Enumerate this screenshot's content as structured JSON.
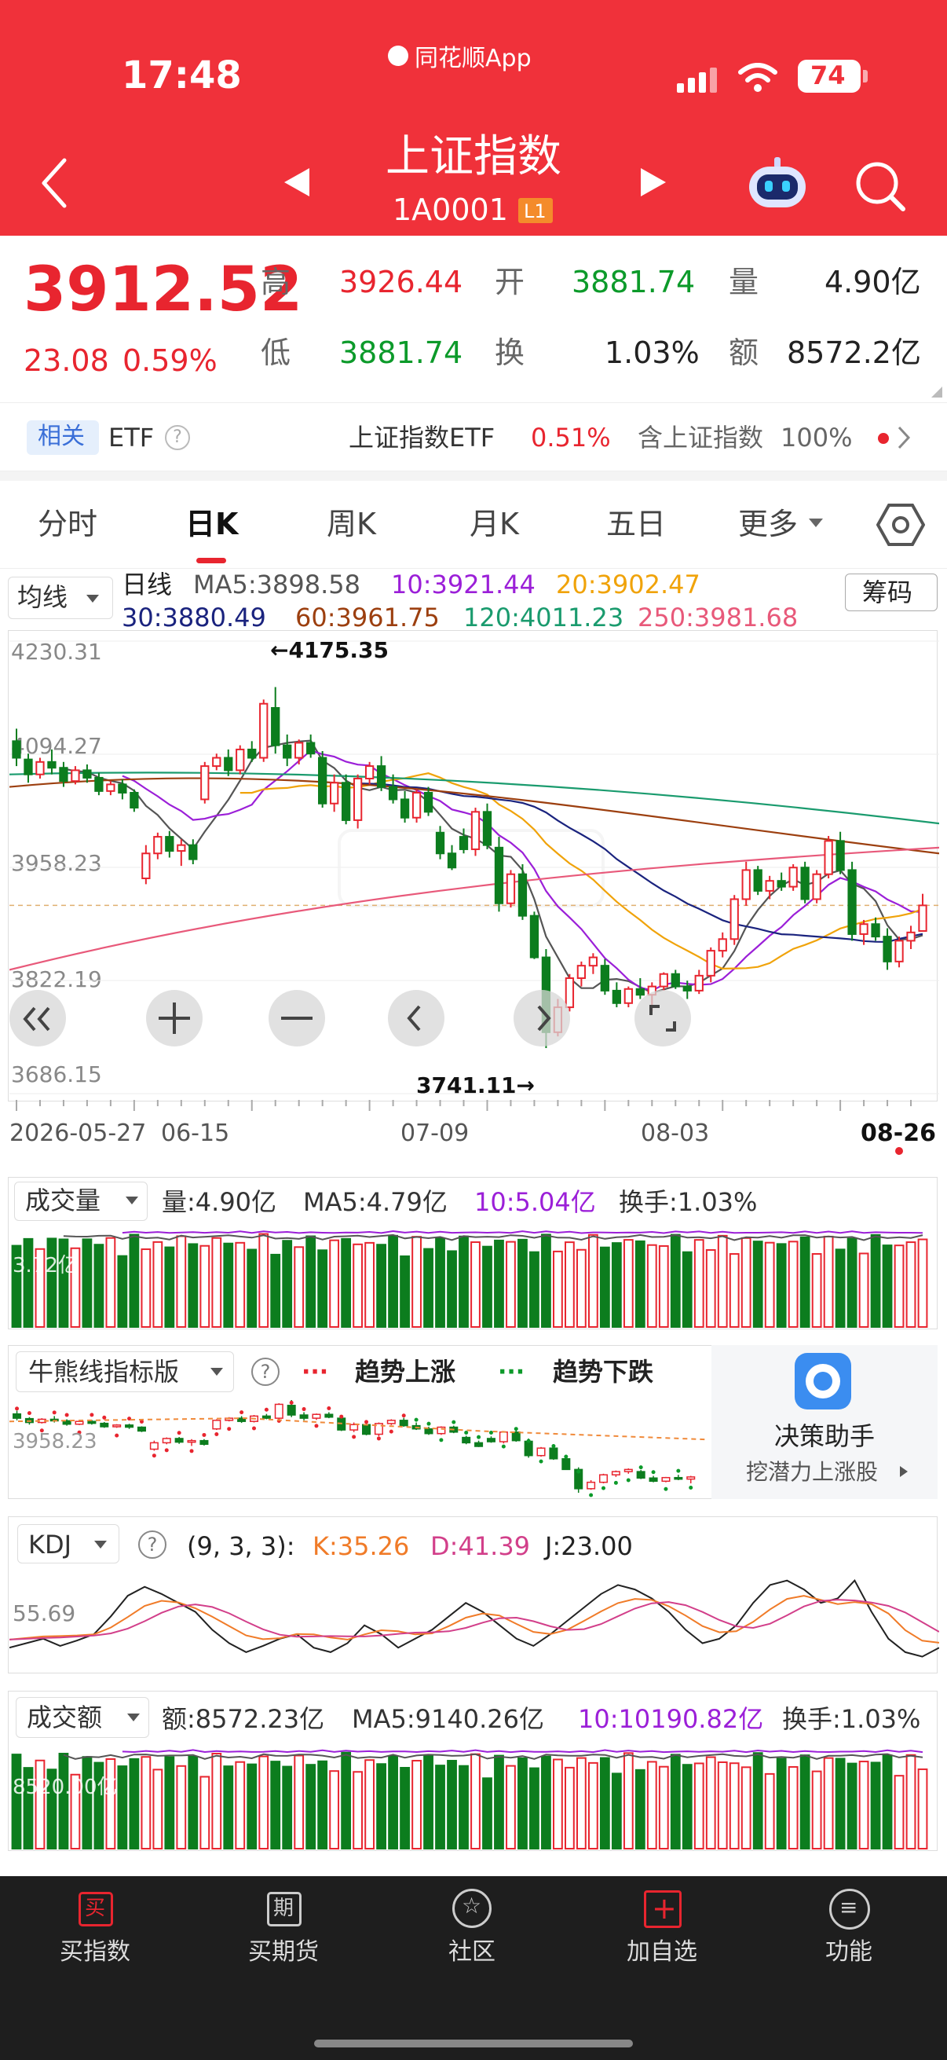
{
  "status": {
    "time": "17:48",
    "app_name": "同花顺App",
    "battery": "74"
  },
  "nav": {
    "title": "上证指数",
    "code": "1A0001",
    "badge": "L1"
  },
  "quote": {
    "price": "3912.52",
    "change": "23.08",
    "pct": "0.59%",
    "high_label": "高",
    "high": "3926.44",
    "low_label": "低",
    "low": "3881.74",
    "open_label": "开",
    "open": "3881.74",
    "turnover_label": "换",
    "turnover": "1.03%",
    "vol_label": "量",
    "vol": "4.90亿",
    "amt_label": "额",
    "amt": "8572.2亿"
  },
  "etf": {
    "tag": "相关",
    "name": "ETF",
    "right_name": "上证指数ETF",
    "right_pct": "0.51%",
    "holding": "含上证指数",
    "holding_pct": "100%"
  },
  "tabs": [
    "分时",
    "日K",
    "周K",
    "月K",
    "五日",
    "更多"
  ],
  "ma": {
    "selector": "均线",
    "kind": "日线",
    "ma5": "MA5:3898.58",
    "ma10": "10:3921.44",
    "ma20": "20:3902.47",
    "ma30": "30:3880.49",
    "ma60": "60:3961.75",
    "ma120": "120:4011.23",
    "ma250": "250:3981.68",
    "chip_btn": "筹码"
  },
  "colors": {
    "up": "#e8252f",
    "down": "#0c7d1e",
    "ma5": "#555555",
    "ma10": "#9b1fd8",
    "ma20": "#f0a30a",
    "ma30": "#1a237e",
    "ma60": "#9c3f0f",
    "ma120": "#1a9b6e",
    "ma250": "#e8597a"
  },
  "kchart": {
    "y_labels": [
      "4230.31",
      "4094.27",
      "3958.23",
      "3822.19",
      "3686.15"
    ],
    "max_label": "←4175.35",
    "min_label": "3741.11→",
    "dates": [
      "2026-05-27",
      "06-15",
      "07-09",
      "08-03",
      "08-26"
    ]
  },
  "volume": {
    "selector": "成交量",
    "v": "量:4.90亿",
    "ma5": "MA5:4.79亿",
    "ma10": "10:5.04亿",
    "hs": "换手:1.03%",
    "axis": "3.72亿"
  },
  "bull": {
    "selector": "牛熊线指标版",
    "up": "趋势上涨",
    "down": "趋势下跌",
    "axis": "3958.23",
    "assistant_title": "决策助手",
    "assistant_sub": "挖潜力上涨股"
  },
  "kdj": {
    "selector": "KDJ",
    "params": "(9, 3, 3):",
    "k": "K:35.26",
    "d": "D:41.39",
    "j": "J:23.00",
    "axis": "55.69"
  },
  "amount": {
    "selector": "成交额",
    "v": "额:8572.23亿",
    "ma5": "MA5:9140.26亿",
    "ma10": "10:10190.82亿",
    "hs": "换手:1.03%",
    "axis": "8520.00亿"
  },
  "bottom": [
    {
      "label": "买指数",
      "icon": "买"
    },
    {
      "label": "买期货",
      "icon": "期"
    },
    {
      "label": "社区",
      "icon": ""
    },
    {
      "label": "加自选",
      "icon": "+"
    },
    {
      "label": "功能",
      "icon": "≡"
    }
  ],
  "chart_data": {
    "type": "candlestick",
    "title": "上证指数 日K",
    "ylim": [
      3686.15,
      4230.31
    ],
    "x_ticks": [
      "2026-05-27",
      "06-15",
      "07-09",
      "08-03",
      "08-26"
    ],
    "ohlc": [
      [
        4110,
        4125,
        4080,
        4090
      ],
      [
        4088,
        4095,
        4060,
        4070
      ],
      [
        4070,
        4090,
        4065,
        4085
      ],
      [
        4085,
        4100,
        4070,
        4078
      ],
      [
        4078,
        4085,
        4055,
        4062
      ],
      [
        4062,
        4080,
        4058,
        4075
      ],
      [
        4075,
        4082,
        4060,
        4066
      ],
      [
        4066,
        4072,
        4045,
        4050
      ],
      [
        4050,
        4062,
        4045,
        4058
      ],
      [
        4058,
        4064,
        4040,
        4048
      ],
      [
        4048,
        4052,
        4025,
        4030
      ],
      [
        3945,
        3985,
        3938,
        3975
      ],
      [
        3975,
        4000,
        3968,
        3995
      ],
      [
        3995,
        4002,
        3970,
        3978
      ],
      [
        3978,
        3992,
        3960,
        3985
      ],
      [
        3985,
        3992,
        3962,
        3968
      ],
      [
        4040,
        4085,
        4035,
        4080
      ],
      [
        4080,
        4095,
        4075,
        4090
      ],
      [
        4090,
        4100,
        4068,
        4075
      ],
      [
        4075,
        4105,
        4070,
        4100
      ],
      [
        4100,
        4110,
        4085,
        4090
      ],
      [
        4090,
        4160,
        4085,
        4155
      ],
      [
        4150,
        4175,
        4095,
        4105
      ],
      [
        4105,
        4118,
        4080,
        4090
      ],
      [
        4090,
        4112,
        4082,
        4108
      ],
      [
        4108,
        4118,
        4090,
        4095
      ],
      [
        4090,
        4098,
        4030,
        4035
      ],
      [
        4035,
        4070,
        4025,
        4060
      ],
      [
        4060,
        4070,
        4010,
        4015
      ],
      [
        4015,
        4070,
        4005,
        4065
      ],
      [
        4065,
        4085,
        4058,
        4080
      ],
      [
        4080,
        4092,
        4050,
        4055
      ],
      [
        4055,
        4070,
        4035,
        4040
      ],
      [
        4040,
        4050,
        4012,
        4018
      ],
      [
        4018,
        4052,
        4012,
        4048
      ],
      [
        4048,
        4055,
        4020,
        4025
      ],
      [
        4000,
        4008,
        3968,
        3975
      ],
      [
        3975,
        3985,
        3955,
        3958
      ],
      [
        3995,
        4005,
        3975,
        3980
      ],
      [
        3980,
        4030,
        3972,
        4025
      ],
      [
        4025,
        4035,
        3980,
        3985
      ],
      [
        3982,
        3995,
        3905,
        3915
      ],
      [
        3915,
        3955,
        3910,
        3950
      ],
      [
        3950,
        3962,
        3895,
        3900
      ],
      [
        3900,
        3905,
        3848,
        3850
      ],
      [
        3850,
        3860,
        3741,
        3760
      ],
      [
        3760,
        3800,
        3755,
        3790
      ],
      [
        3790,
        3830,
        3785,
        3825
      ],
      [
        3825,
        3845,
        3815,
        3840
      ],
      [
        3840,
        3855,
        3830,
        3850
      ],
      [
        3840,
        3848,
        3805,
        3810
      ],
      [
        3810,
        3820,
        3790,
        3795
      ],
      [
        3795,
        3815,
        3790,
        3812
      ],
      [
        3812,
        3825,
        3800,
        3805
      ],
      [
        3805,
        3820,
        3785,
        3815
      ],
      [
        3815,
        3832,
        3810,
        3830
      ],
      [
        3830,
        3835,
        3812,
        3815
      ],
      [
        3815,
        3822,
        3800,
        3810
      ],
      [
        3810,
        3835,
        3806,
        3828
      ],
      [
        3828,
        3862,
        3820,
        3858
      ],
      [
        3858,
        3880,
        3850,
        3872
      ],
      [
        3872,
        3925,
        3865,
        3920
      ],
      [
        3920,
        3965,
        3912,
        3955
      ],
      [
        3955,
        3960,
        3925,
        3930
      ],
      [
        3930,
        3948,
        3920,
        3942
      ],
      [
        3942,
        3952,
        3930,
        3935
      ],
      [
        3935,
        3962,
        3930,
        3958
      ],
      [
        3958,
        3965,
        3915,
        3920
      ],
      [
        3920,
        3955,
        3915,
        3950
      ],
      [
        3950,
        3996,
        3945,
        3990
      ],
      [
        3990,
        4001,
        3950,
        3955
      ],
      [
        3955,
        3965,
        3870,
        3878
      ],
      [
        3878,
        3895,
        3865,
        3890
      ],
      [
        3890,
        3898,
        3870,
        3875
      ],
      [
        3875,
        3885,
        3835,
        3845
      ],
      [
        3845,
        3875,
        3838,
        3870
      ],
      [
        3870,
        3888,
        3860,
        3880
      ],
      [
        3881.74,
        3926.44,
        3881.74,
        3912.52
      ]
    ]
  }
}
